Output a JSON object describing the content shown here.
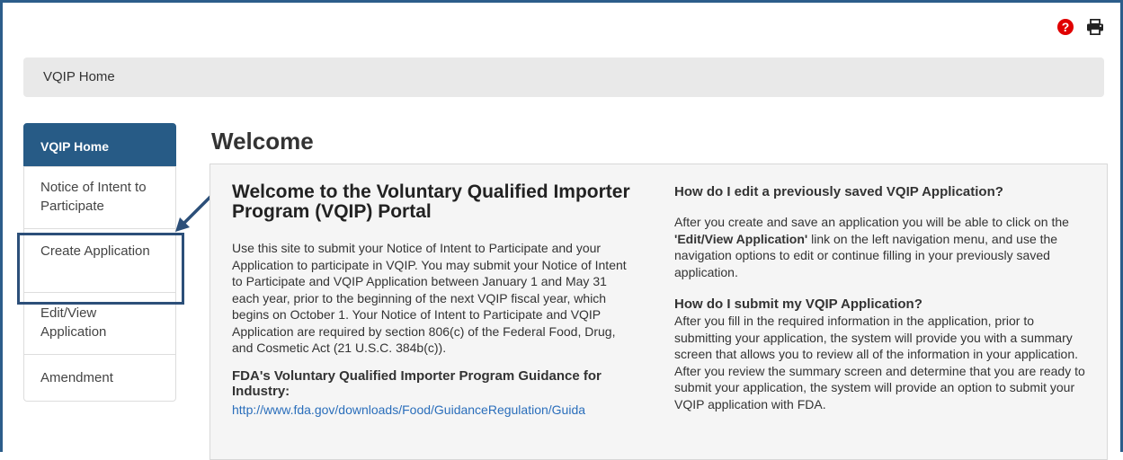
{
  "header": {
    "breadcrumb": "VQIP Home"
  },
  "icons": {
    "help": "question-circle-icon",
    "print": "printer-icon",
    "help_color": "#e00000"
  },
  "sidebar": {
    "items": [
      {
        "label": "VQIP Home",
        "active": true
      },
      {
        "label": "Notice of Intent to Participate",
        "active": false
      },
      {
        "label": "Create Application",
        "active": false
      },
      {
        "label": "Edit/View Application",
        "active": false
      },
      {
        "label": "Amendment",
        "active": false
      }
    ]
  },
  "main": {
    "title": "Welcome",
    "left": {
      "heading": "Welcome to the Voluntary Qualified Importer Program (VQIP) Portal",
      "paragraph": "Use this site to submit your Notice of Intent to Participate and your Application to participate in VQIP. You may submit your Notice of Intent to Participate and VQIP Application between January 1 and May 31 each year, prior to the beginning of the next VQIP fiscal year, which begins on October 1. Your Notice of Intent to Participate and VQIP Application are required by section 806(c) of the Federal Food, Drug, and Cosmetic Act (21 U.S.C. 384b(c)).",
      "guidance_heading": "FDA's Voluntary Qualified Importer Program Guidance for Industry:",
      "guidance_link": "http://www.fda.gov/downloads/Food/GuidanceRegulation/Guida"
    },
    "right": {
      "q1": "How do I edit a previously saved VQIP Application?",
      "a1_before": "After you create and save an application you will be able to click on the ",
      "a1_bold": "'Edit/View Application'",
      "a1_after": " link on the left navigation menu, and use the navigation options to edit or continue filling in your previously saved application.",
      "q2": "How do I submit my VQIP Application?",
      "a2": "After you fill in the required information in the application, prior to submitting your application, the system will provide you with a summary screen that allows you to review all of the information in your application. After you review the summary screen and determine that you are ready to submit your application, the system will provide an option to submit your VQIP application with FDA."
    }
  },
  "colors": {
    "accent": "#275b86",
    "frame": "#2c5d8a",
    "highlight": "#2c4f79",
    "link": "#2a6ebb"
  }
}
